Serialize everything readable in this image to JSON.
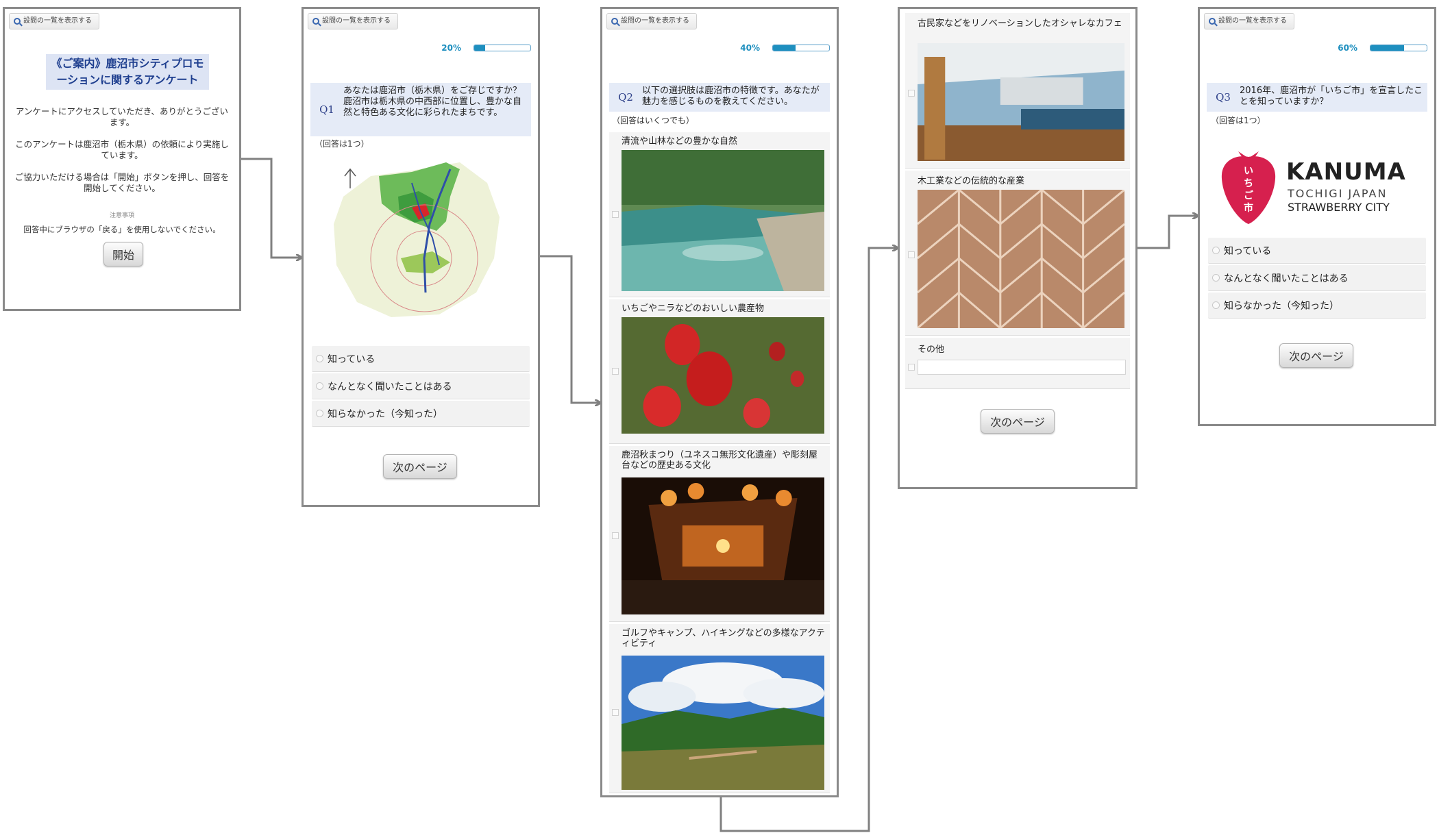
{
  "top_button_label": "設問の一覧を表示する",
  "panel1": {
    "title": "《ご案内》鹿沼市シティプロモーションに関するアンケート",
    "para1": "アンケートにアクセスしていただき、ありがとうございます。",
    "para2": "このアンケートは鹿沼市（栃木県）の依頼により実施しています。",
    "para3": "ご協力いただける場合は「開始」ボタンを押し、回答を開始してください。",
    "notice_label": "注意事項",
    "notice": "回答中にブラウザの「戻る」を使用しないでください。",
    "start_button": "開始"
  },
  "panel2": {
    "progress": "20%",
    "progress_value": 0.2,
    "qnum": "Q1",
    "question": "あなたは鹿沼市（栃木県）をご存じですか？",
    "question_note": "鹿沼市は栃木県の中西部に位置し、豊かな自然と特色ある文化に彩られたまちです。",
    "answer_hint": "（回答は1つ）",
    "options": [
      "知っている",
      "なんとなく聞いたことはある",
      "知らなかった（今知った）"
    ],
    "next_button": "次のページ"
  },
  "panel3": {
    "progress": "40%",
    "progress_value": 0.4,
    "qnum": "Q2",
    "question": "以下の選択肢は鹿沼市の特徴です。あなたが魅力を感じるものを教えてください。",
    "answer_hint": "（回答はいくつでも）",
    "choices": [
      "清流や山林などの豊かな自然",
      "いちごやニラなどのおいしい農産物",
      "鹿沼秋まつり（ユネスコ無形文化遺産）や彫刻屋台などの歴史ある文化",
      "ゴルフやキャンプ、ハイキングなどの多様なアクティビティ"
    ]
  },
  "panel4": {
    "choices": [
      "古民家などをリノベーションしたオシャレなカフェ",
      "木工業などの伝統的な産業"
    ],
    "other_label": "その他",
    "next_button": "次のページ"
  },
  "panel5": {
    "progress": "60%",
    "progress_value": 0.6,
    "qnum": "Q3",
    "question": "2016年、鹿沼市が「いちご市」を宣言したことを知っていますか？",
    "answer_hint": "（回答は1つ）",
    "logo": {
      "badge_text": "いちご市",
      "name": "KANUMA",
      "sub": "TOCHIGI JAPAN",
      "tagline": "STRAWBERRY CITY"
    },
    "options": [
      "知っている",
      "なんとなく聞いたことはある",
      "知らなかった（今知った）"
    ],
    "next_button": "次のページ"
  },
  "colors": {
    "title_bg": "#dde4f4",
    "title_text": "#1f3f8f",
    "accent": "#1e8fbf",
    "question_bg": "#e5ebf7",
    "panel_border": "#8a8a8a",
    "strawberry": "#d6204e"
  }
}
